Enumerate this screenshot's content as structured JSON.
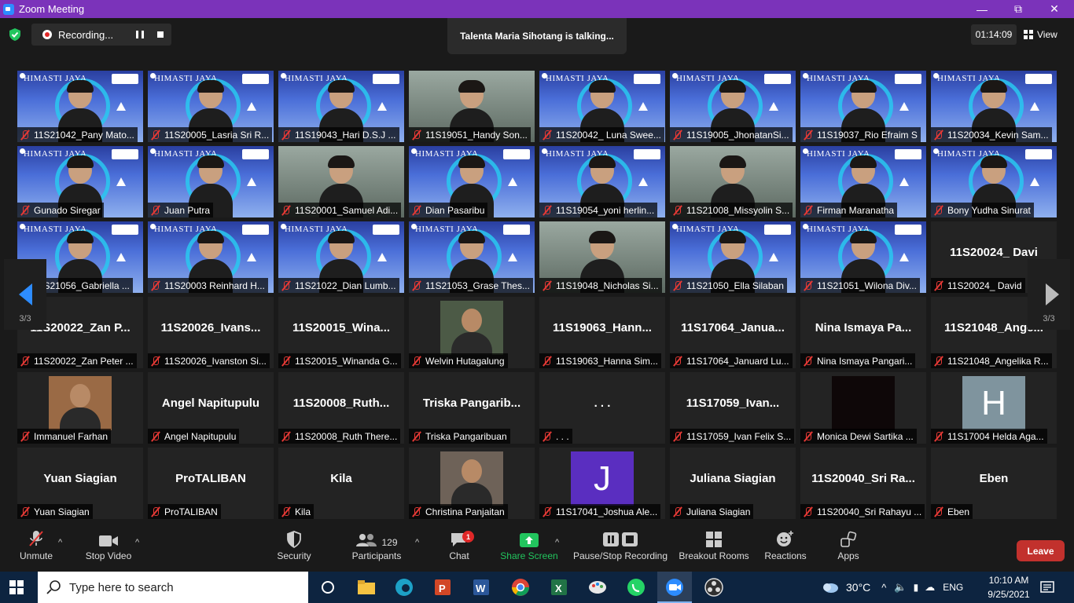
{
  "window": {
    "title": "Zoom Meeting"
  },
  "topbar": {
    "recording_label": "Recording...",
    "talking_text": "Talenta Maria Sihotang is talking...",
    "timer": "01:14:09",
    "view_label": "View"
  },
  "page": {
    "left_indicator": "3/3",
    "right_indicator": "3/3"
  },
  "tiles": [
    {
      "type": "banner",
      "name": "11S21042_Pany Mato...",
      "banner": "HIMASTI JAYA"
    },
    {
      "type": "banner",
      "name": "11S20005_Lasria Sri R...",
      "banner": "HIMASTI JAYA"
    },
    {
      "type": "banner",
      "name": "11S19043_Hari D.S.J ...",
      "banner": "HIMASTI JAYA"
    },
    {
      "type": "video",
      "name": "11S19051_Handy Son..."
    },
    {
      "type": "banner",
      "name": "11S20042_ Luna Swee...",
      "banner": "HIMASTI JAYA"
    },
    {
      "type": "banner",
      "name": "11S19005_JhonatanSi...",
      "banner": "HIMASTI JAYA"
    },
    {
      "type": "banner",
      "name": "11S19037_Rio Efraim S",
      "banner": "HIMASTI JAYA"
    },
    {
      "type": "banner",
      "name": "11S20034_Kevin Sam...",
      "banner": "HIMASTI JAYA"
    },
    {
      "type": "banner",
      "name": "Gunado Siregar",
      "banner": "HIMASTI JAYA"
    },
    {
      "type": "banner",
      "name": "Juan Putra",
      "banner": "HIMASTI JAYA"
    },
    {
      "type": "video",
      "name": "11S20001_Samuel Adi..."
    },
    {
      "type": "banner",
      "name": "Dian Pasaribu",
      "banner": "HIMASTI JAYA"
    },
    {
      "type": "banner",
      "name": "11S19054_yoni herlin...",
      "banner": "HIMASTI JAYA"
    },
    {
      "type": "video",
      "name": "11S21008_Missyolin S..."
    },
    {
      "type": "banner",
      "name": "Firman Maranatha",
      "banner": "HIMASTI JAYA"
    },
    {
      "type": "banner",
      "name": "Bony Yudha Sinurat",
      "banner": "HIMASTI JAYA"
    },
    {
      "type": "banner",
      "name": "11S21056_Gabriella ...",
      "banner": "HIMASTI JAYA"
    },
    {
      "type": "banner",
      "name": "11S20003 Reinhard H...",
      "banner": "HIMASTI JAYA"
    },
    {
      "type": "banner",
      "name": "11S21022_Dian Lumb...",
      "banner": "HIMASTI JAYA"
    },
    {
      "type": "banner",
      "name": "11S21053_Grase Thes...",
      "banner": "HIMASTI JAYA"
    },
    {
      "type": "video",
      "name": "11S19048_Nicholas Si..."
    },
    {
      "type": "banner",
      "name": "11S21050_Ella Silaban",
      "banner": "HIMASTI JAYA"
    },
    {
      "type": "banner",
      "name": "11S21051_Wilona Div...",
      "banner": "HIMASTI JAYA"
    },
    {
      "type": "text",
      "big": "11S20024_ Davi",
      "name": "11S20024_ David"
    },
    {
      "type": "text",
      "big": "11S20022_Zan P...",
      "name": "11S20022_Zan Peter ..."
    },
    {
      "type": "text",
      "big": "11S20026_Ivans...",
      "name": "11S20026_Ivanston Si..."
    },
    {
      "type": "text",
      "big": "11S20015_Wina...",
      "name": "11S20015_Winanda G..."
    },
    {
      "type": "photo",
      "name": "Welvin Hutagalung",
      "color": "#4c5a46"
    },
    {
      "type": "text",
      "big": "11S19063_Hann...",
      "name": "11S19063_Hanna Sim..."
    },
    {
      "type": "text",
      "big": "11S17064_Janua...",
      "name": "11S17064_Januard Lu..."
    },
    {
      "type": "text",
      "big": "Nina Ismaya Pa...",
      "name": "Nina Ismaya Pangari..."
    },
    {
      "type": "text",
      "big": "11S21048_Ange...",
      "name": "11S21048_Angelika R..."
    },
    {
      "type": "photo",
      "name": "Immanuel Farhan",
      "color": "#9a6a45"
    },
    {
      "type": "text",
      "big": "Angel Napitupulu",
      "name": "Angel Napitupulu"
    },
    {
      "type": "text",
      "big": "11S20008_Ruth...",
      "name": "11S20008_Ruth There..."
    },
    {
      "type": "text",
      "big": "Triska  Pangarib...",
      "name": "Triska Pangaribuan"
    },
    {
      "type": "text",
      "big": ". . .",
      "name": ". . ."
    },
    {
      "type": "text",
      "big": "11S17059_Ivan...",
      "name": "11S17059_Ivan Felix S..."
    },
    {
      "type": "photo",
      "name": "Monica Dewi Sartika ...",
      "color": "#0e0708"
    },
    {
      "type": "letter",
      "letter": "H",
      "name": "11S17004 Helda Aga...",
      "color": "#7f949e"
    },
    {
      "type": "text",
      "big": "Yuan Siagian",
      "name": "Yuan Siagian"
    },
    {
      "type": "text",
      "big": "ProTALIBAN",
      "name": "ProTALIBAN"
    },
    {
      "type": "text",
      "big": "Kila",
      "name": "Kila"
    },
    {
      "type": "photo",
      "name": "Christina Panjaitan",
      "color": "#6e6258"
    },
    {
      "type": "letter",
      "letter": "J",
      "name": "11S17041_Joshua Ale...",
      "color": "#5a2ec0"
    },
    {
      "type": "text",
      "big": "Juliana Siagian",
      "name": "Juliana Siagian"
    },
    {
      "type": "text",
      "big": "11S20040_Sri Ra...",
      "name": "11S20040_Sri Rahayu ..."
    },
    {
      "type": "text",
      "big": "Eben",
      "name": "Eben"
    }
  ],
  "toolbar": {
    "unmute": "Unmute",
    "stop_video": "Stop Video",
    "security": "Security",
    "participants": "Participants",
    "participants_count": "129",
    "chat": "Chat",
    "chat_badge": "1",
    "share_screen": "Share Screen",
    "pause_stop_recording": "Pause/Stop Recording",
    "breakout_rooms": "Breakout Rooms",
    "reactions": "Reactions",
    "apps": "Apps",
    "leave": "Leave"
  },
  "taskbar": {
    "search_placeholder": "Type here to search",
    "temperature": "30°C",
    "language": "ENG",
    "time": "10:10 AM",
    "date": "9/25/2021"
  },
  "colors": {
    "titlebar": "#7b33ba",
    "leave": "#c2312d",
    "share": "#22c55e",
    "accent": "#2d8cff"
  }
}
